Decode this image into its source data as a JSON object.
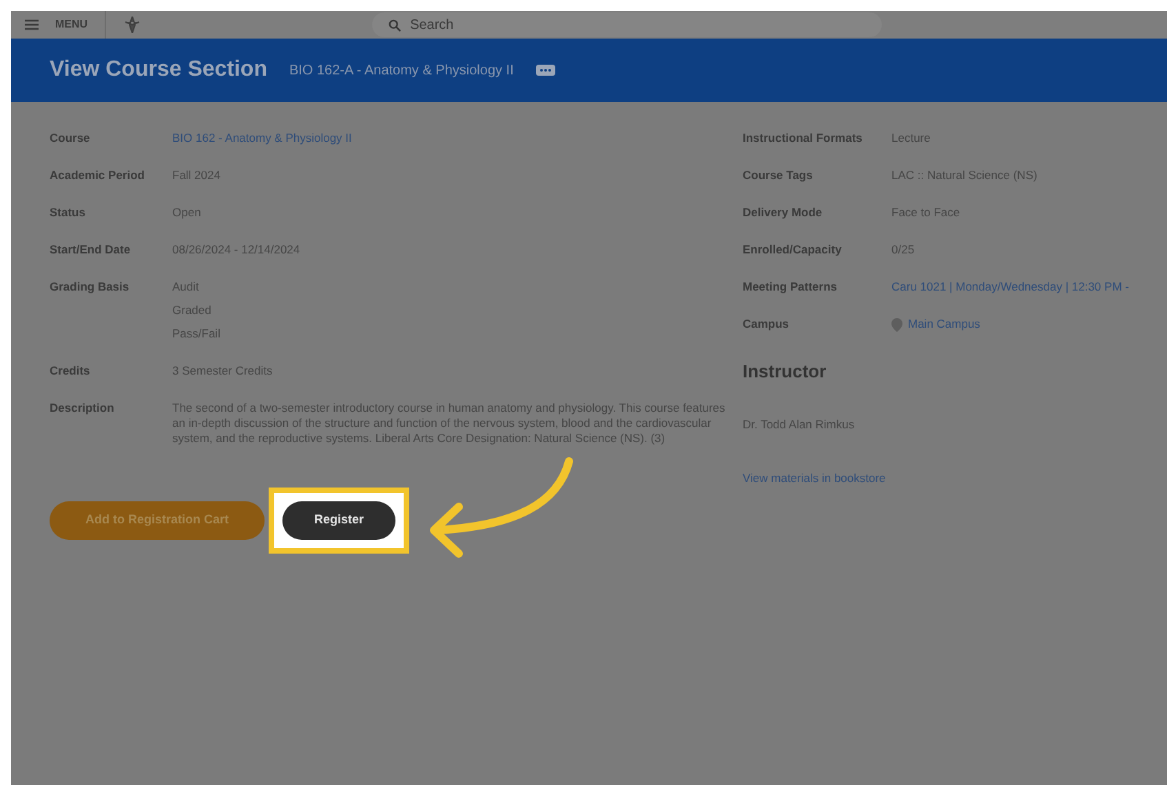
{
  "top_bar": {
    "menu_label": "MENU",
    "search": {
      "placeholder": "Search"
    }
  },
  "header": {
    "title": "View Course Section",
    "subtitle": "BIO 162-A - Anatomy & Physiology II"
  },
  "left_fields": [
    {
      "label": "Course",
      "values": [
        "BIO 162 - Anatomy & Physiology II"
      ],
      "kind": "link"
    },
    {
      "label": "Academic Period",
      "values": [
        "Fall 2024"
      ],
      "kind": "text"
    },
    {
      "label": "Status",
      "values": [
        "Open"
      ],
      "kind": "text"
    },
    {
      "label": "Start/End Date",
      "values": [
        "08/26/2024 - 12/14/2024"
      ],
      "kind": "text"
    },
    {
      "label": "Grading Basis",
      "values": [
        "Audit",
        "Graded",
        "Pass/Fail"
      ],
      "kind": "text"
    },
    {
      "label": "Credits",
      "values": [
        "3 Semester Credits"
      ],
      "kind": "text"
    },
    {
      "label": "Description",
      "values": [
        "The second of a two-semester introductory course in human anatomy and physiology. This course features an in-depth discussion of the structure and function of the nervous system, blood and the cardiovascular system, and the reproductive systems. Liberal Arts Core Designation: Natural Science (NS). (3)"
      ],
      "kind": "text"
    }
  ],
  "right_fields": [
    {
      "label": "Instructional Formats",
      "values": [
        "Lecture"
      ],
      "kind": "text"
    },
    {
      "label": "Course Tags",
      "values": [
        "LAC :: Natural Science (NS)"
      ],
      "kind": "text"
    },
    {
      "label": "Delivery Mode",
      "values": [
        "Face to Face"
      ],
      "kind": "text"
    },
    {
      "label": "Enrolled/Capacity",
      "values": [
        "0/25"
      ],
      "kind": "text"
    },
    {
      "label": "Meeting Patterns",
      "values": [
        "Caru 1021 | Monday/Wednesday | 12:30 PM -"
      ],
      "kind": "link"
    },
    {
      "label": "Campus",
      "values": [
        "Main Campus"
      ],
      "kind": "location"
    }
  ],
  "instructor": {
    "heading": "Instructor",
    "name": "Dr. Todd Alan Rimkus",
    "bookstore_link": "View materials in bookstore"
  },
  "buttons": [
    {
      "label": "Add to Registration Cart",
      "kind": "secondary",
      "highlighted": false
    },
    {
      "label": "Register",
      "kind": "primary",
      "highlighted": true
    }
  ]
}
